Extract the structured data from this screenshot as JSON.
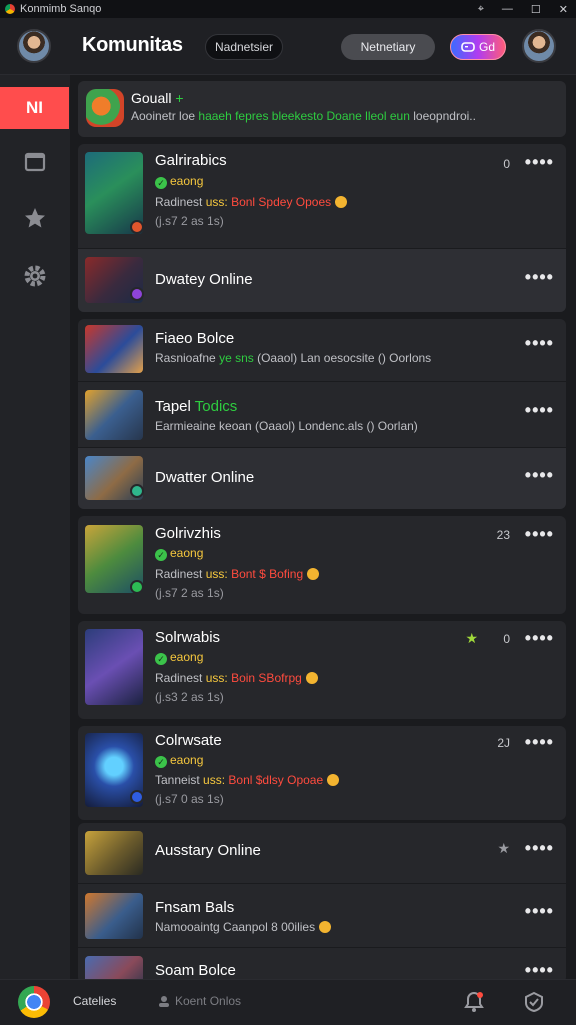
{
  "titlebar": {
    "title": "Konmimb Sanqo",
    "controls": [
      "⌖",
      "—",
      "☐",
      "✕"
    ]
  },
  "header": {
    "brand": "Komunitas",
    "search_pill": "Nadnetsier",
    "filter_pill": "Netnetiary",
    "go_pill": "Gd"
  },
  "sidebar": {
    "active_label": "NI"
  },
  "featured": {
    "title": "Gouall",
    "title_mark": "+",
    "line_prefix": "Aooinetr loe",
    "line_green": "haaeh fepres bleekesto Doane  lleol eun",
    "line_suffix": "loeopndroi.."
  },
  "items": [
    {
      "title": "Galrirabics",
      "status": "eaong",
      "line1_prefix": "Radinest",
      "line1_mid": "uss:",
      "line1_red": "Bonl Spdey Opoes",
      "line2": "(j.s7 2 as 1s)",
      "count": "0"
    },
    {
      "title": "Dwatey Online"
    },
    {
      "title": "Fiaeo Bolce",
      "line_prefix": "Rasnioafne",
      "line_green": "ye sns",
      "line_rest": "(Oaaol) Lan oesocsite () Oorlons"
    },
    {
      "title_white": "Tapel",
      "title_green": "Todics",
      "line": "Earmieaine keoan (Oaaol) Londenc.als () Oorlan)"
    },
    {
      "title": "Dwatter Online"
    },
    {
      "title": "Golrivzhis",
      "status": "eaong",
      "line1_prefix": "Radinest",
      "line1_mid": "uss:",
      "line1_red": "Bont $ Bofing",
      "line2": "(j.s7 2 as 1s)",
      "count": "23"
    },
    {
      "title": "Solrwabis",
      "status": "eaong",
      "line1_prefix": "Radinest",
      "line1_mid": "uss:",
      "line1_red": "Boin SBofrpg",
      "line2": "(j.s3 2 as 1s)",
      "count": "0"
    },
    {
      "title": "Colrwsate",
      "status": "eaong",
      "line1_prefix": "Tanneist",
      "line1_mid": "uss:",
      "line1_red": "Bonl $dlsy Opoae",
      "line2": "(j.s7 0 as 1s)",
      "count": "2J"
    },
    {
      "title": "Ausstary Online"
    },
    {
      "title": "Fnsam Bals",
      "line": "Namooaintg Caanpol 8 00ilies"
    },
    {
      "title": "Soam Bolce"
    }
  ],
  "more_label": "••••",
  "bottom": {
    "left_label": "Catelies",
    "center_label": "Koent Onlos"
  },
  "colors": {
    "accent_red": "#ff4d4d",
    "online_green": "#2ecc40",
    "alert_red": "#ff4b3e",
    "panel": "#26272b"
  }
}
